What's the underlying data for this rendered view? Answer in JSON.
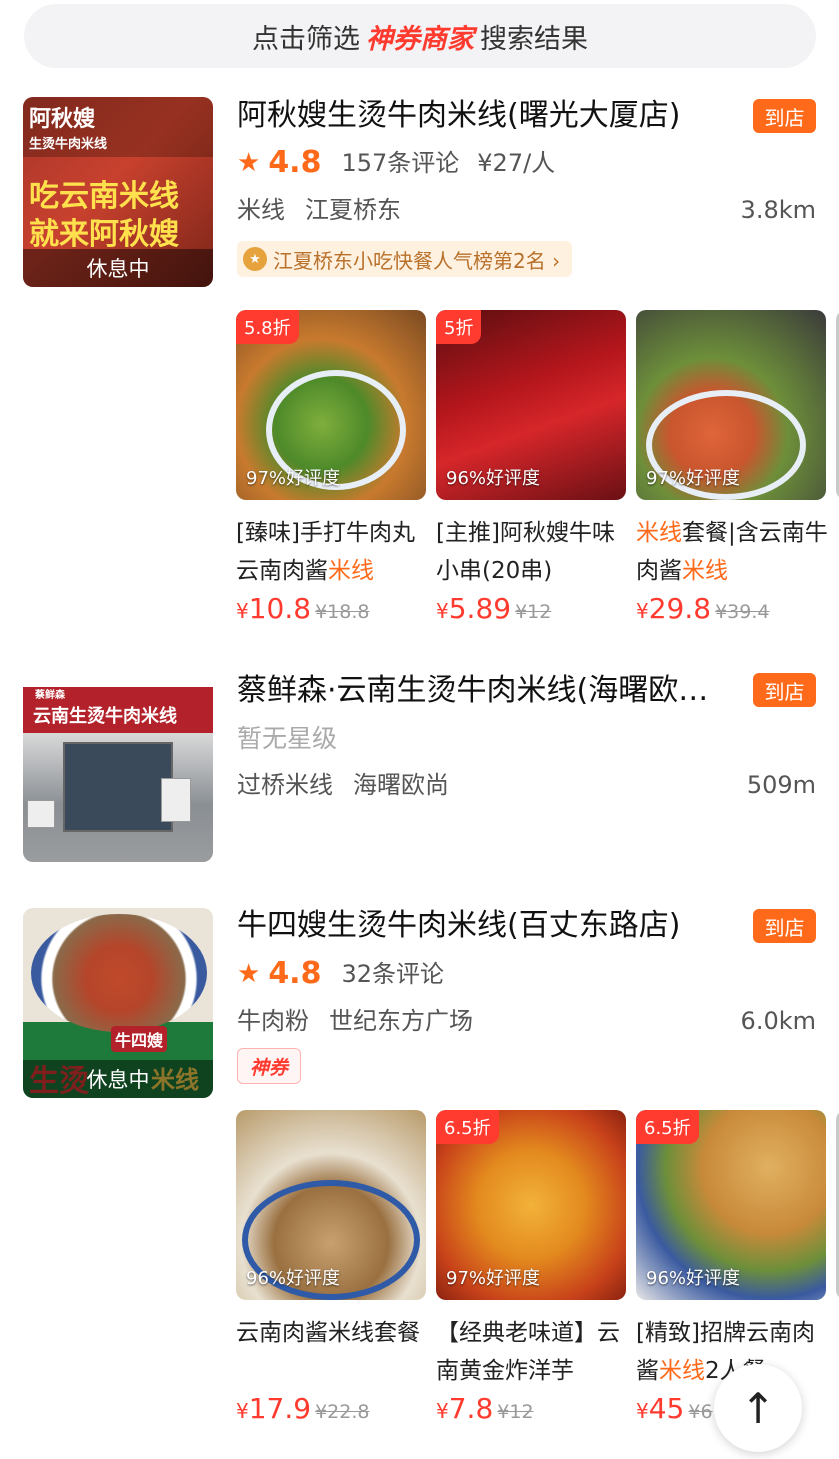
{
  "filter_bar": {
    "prefix": "点击筛选",
    "brand": "神券商家",
    "suffix": "搜索结果"
  },
  "colors": {
    "accent_orange": "#ff6a1a",
    "price_red": "#ff3a2f",
    "filter_bg": "#f3f3f5"
  },
  "shops": [
    {
      "name": "阿秋嫂生烫牛肉米线(曙光大厦店)",
      "visit_label": "到店",
      "rating": "4.8",
      "reviews": "157条评论",
      "price_per_person": "¥27/人",
      "tags": [
        "米线",
        "江夏桥东"
      ],
      "distance": "3.8km",
      "status": "休息中",
      "thumb_texts": [
        "阿秋嫂",
        "生烫牛肉米线",
        "吃云南米线",
        "就来阿秋嫂"
      ],
      "rank_badge": "江夏桥东小吃快餐人气榜第2名 ›",
      "deals": [
        {
          "discount": "5.8折",
          "rate": "97%好评度",
          "title_parts": [
            {
              "t": "[臻味]手打牛肉丸云南肉酱",
              "hl": false
            },
            {
              "t": "米线",
              "hl": true
            }
          ],
          "price": "10.8",
          "old_price": "¥18.8"
        },
        {
          "discount": "5折",
          "rate": "96%好评度",
          "title_parts": [
            {
              "t": "[主推]阿秋嫂牛味小串(20串)",
              "hl": false
            }
          ],
          "price": "5.89",
          "old_price": "¥12"
        },
        {
          "discount": "",
          "rate": "97%好评度",
          "title_parts": [
            {
              "t": "米线",
              "hl": true
            },
            {
              "t": "套餐|含云南牛肉酱",
              "hl": false
            },
            {
              "t": "米线",
              "hl": true
            }
          ],
          "price": "29.8",
          "old_price": "¥39.4"
        }
      ]
    },
    {
      "name": "蔡鲜森·云南生烫牛肉米线(海曙欧尚店)",
      "visit_label": "到店",
      "no_rating": "暂无星级",
      "tags": [
        "过桥米线",
        "海曙欧尚"
      ],
      "distance": "509m",
      "thumb_texts": [
        "蔡鲜森",
        "云南生烫牛肉米线"
      ]
    },
    {
      "name": "牛四嫂生烫牛肉米线(百丈东路店)",
      "visit_label": "到店",
      "rating": "4.8",
      "reviews": "32条评论",
      "tags": [
        "牛肉粉",
        "世纪东方广场"
      ],
      "distance": "6.0km",
      "status": "休息中",
      "thumb_texts": [
        "牛四嫂",
        "生烫",
        "米线"
      ],
      "coupon_badge": "神券",
      "deals": [
        {
          "discount": "",
          "rate": "96%好评度",
          "title_parts": [
            {
              "t": "云南肉酱米线套餐",
              "hl": false
            }
          ],
          "price": "17.9",
          "old_price": "¥22.8"
        },
        {
          "discount": "6.5折",
          "rate": "97%好评度",
          "title_parts": [
            {
              "t": "【经典老味道】云南黄金炸洋芋",
              "hl": false
            }
          ],
          "price": "7.8",
          "old_price": "¥12"
        },
        {
          "discount": "6.5折",
          "rate": "96%好评度",
          "title_parts": [
            {
              "t": "[精致]招牌云南肉酱",
              "hl": false
            },
            {
              "t": "米线",
              "hl": true
            },
            {
              "t": "2人餐",
              "hl": false
            }
          ],
          "price": "45",
          "old_price": "¥6"
        }
      ]
    }
  ],
  "back_to_top": "↑"
}
